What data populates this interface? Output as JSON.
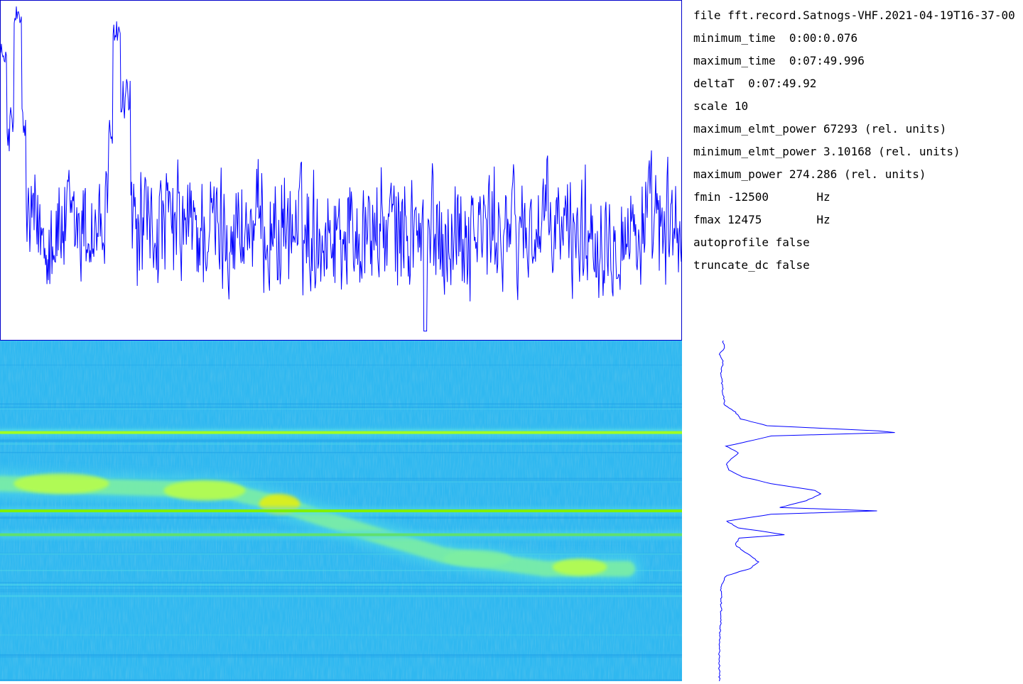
{
  "info": [
    {
      "key": "file",
      "value": "fft.record.Satnogs-VHF.2021-04-19T16-37-00"
    },
    {
      "key": "minimum_time",
      "value": "0:00:0.076"
    },
    {
      "key": "maximum_time",
      "value": "0:07:49.996"
    },
    {
      "key": "deltaT",
      "value": "0:07:49.92"
    },
    {
      "key": "scale",
      "value": "10"
    },
    {
      "key": "maximum_elmt_power",
      "value": "67293 (rel. units)"
    },
    {
      "key": "minimum_elmt_power",
      "value": "3.10168 (rel. units)"
    },
    {
      "key": "maximum_power",
      "value": "274.286 (rel. units)"
    },
    {
      "key": "fmin",
      "value": "-12500       Hz"
    },
    {
      "key": "fmax",
      "value": "12475        Hz"
    },
    {
      "key": "autoprofile",
      "value": "false"
    },
    {
      "key": "truncate_dc",
      "value": "false"
    }
  ],
  "chart_data": [
    {
      "type": "line",
      "title": "",
      "xlabel": "",
      "ylabel": "",
      "color": "#0000ff",
      "x_range": [
        "0:00:0.076",
        "0:07:49.996"
      ],
      "ylim": [
        0,
        100
      ],
      "samples": 480,
      "baseline_mean": 58,
      "noise_range": [
        10,
        55
      ],
      "peaks": [
        {
          "x": 0.003,
          "value": 88
        },
        {
          "x": 0.025,
          "value": 99
        },
        {
          "x": 0.17,
          "value": 94
        }
      ],
      "notes": "relative total power versus time, dense noisy trace"
    },
    {
      "type": "heatmap",
      "title": "",
      "x_range": [
        "0:00:0.076",
        "0:07:49.996"
      ],
      "y_range_hz": [
        -12500,
        12475
      ],
      "colormap": [
        "#1fa0e8",
        "#2fb8f0",
        "#4fd8e8",
        "#7ff0a0",
        "#bfff40",
        "#f0f000"
      ],
      "features": [
        {
          "kind": "constant_carrier",
          "freq_fraction": 0.27,
          "color": "#a0ff20"
        },
        {
          "kind": "constant_carrier",
          "freq_fraction": 0.5,
          "color": "#80f000"
        },
        {
          "kind": "constant_carrier",
          "freq_fraction": 0.57,
          "color": "#60e070"
        },
        {
          "kind": "doppler_trace",
          "points": [
            [
              0.0,
              0.42
            ],
            [
              0.17,
              0.43
            ],
            [
              0.33,
              0.44
            ],
            [
              0.41,
              0.48
            ],
            [
              0.47,
              0.52
            ],
            [
              0.55,
              0.57
            ],
            [
              0.65,
              0.63
            ],
            [
              0.8,
              0.67
            ],
            [
              0.92,
              0.67
            ]
          ]
        }
      ]
    },
    {
      "type": "line",
      "title": "",
      "orientation": "vertical",
      "color": "#0000ff",
      "y_range_hz": [
        -12500,
        12475
      ],
      "profile": [
        [
          0.0,
          3
        ],
        [
          0.02,
          4
        ],
        [
          0.04,
          1
        ],
        [
          0.06,
          3
        ],
        [
          0.1,
          2
        ],
        [
          0.15,
          3
        ],
        [
          0.19,
          4
        ],
        [
          0.21,
          10
        ],
        [
          0.23,
          13
        ],
        [
          0.25,
          28
        ],
        [
          0.265,
          90
        ],
        [
          0.27,
          100
        ],
        [
          0.28,
          30
        ],
        [
          0.3,
          14
        ],
        [
          0.31,
          5
        ],
        [
          0.33,
          12
        ],
        [
          0.36,
          5
        ],
        [
          0.38,
          6
        ],
        [
          0.4,
          14
        ],
        [
          0.42,
          30
        ],
        [
          0.44,
          55
        ],
        [
          0.45,
          58
        ],
        [
          0.47,
          50
        ],
        [
          0.49,
          35
        ],
        [
          0.5,
          90
        ],
        [
          0.51,
          30
        ],
        [
          0.53,
          5
        ],
        [
          0.55,
          12
        ],
        [
          0.57,
          38
        ],
        [
          0.58,
          12
        ],
        [
          0.6,
          10
        ],
        [
          0.63,
          18
        ],
        [
          0.65,
          23
        ],
        [
          0.67,
          18
        ],
        [
          0.69,
          5
        ],
        [
          0.72,
          2
        ],
        [
          0.8,
          2
        ],
        [
          0.9,
          1
        ],
        [
          1.0,
          1
        ]
      ]
    }
  ]
}
